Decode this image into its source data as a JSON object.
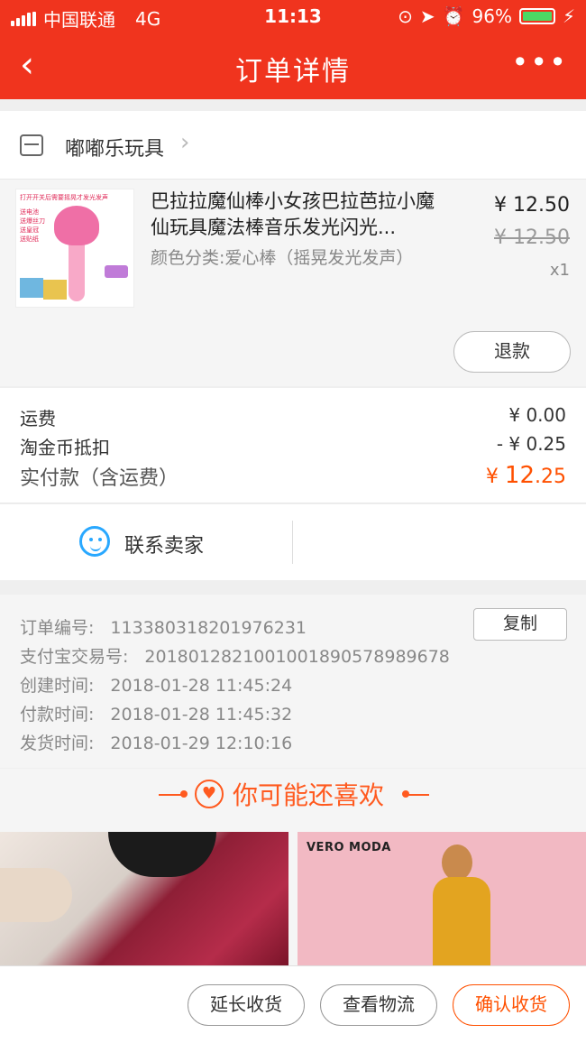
{
  "status": {
    "carrier": "中国联通",
    "network": "4G",
    "time": "11:13",
    "battery": "96%"
  },
  "nav": {
    "title": "订单详情",
    "back_icon": "back-chevron-icon",
    "more_icon": "more-dots-icon"
  },
  "shop": {
    "name": "嘟嘟乐玩具"
  },
  "product": {
    "title": "巴拉拉魔仙棒小女孩巴拉芭拉小魔仙玩具魔法棒音乐发光闪光...",
    "sku": "颜色分类:爱心棒（摇晃发光发声）",
    "price": "¥ 12.50",
    "original_price": "¥ 12.50",
    "qty": "x1",
    "thumb_text": "打开开关后需要摇晃才发光发声",
    "thumb_text2": "送电池 送爆丝刀 送皇冠 送贴纸",
    "refund_label": "退款"
  },
  "costs": {
    "shipping_label": "运费",
    "shipping_value": "¥ 0.00",
    "coin_label": "淘金币抵扣",
    "coin_value": "- ¥ 0.25",
    "total_label": "实付款（含运费）",
    "total_prefix": "¥ ",
    "total_int": "12",
    "total_dec": ".25"
  },
  "contact": {
    "label": "联系卖家"
  },
  "order_info": {
    "order_no_label": "订单编号:",
    "order_no": "113380318201976231",
    "alipay_label": "支付宝交易号:",
    "alipay_no": "2018012821001001890578989678",
    "created_label": "创建时间:",
    "created": "2018-01-28 11:45:24",
    "paid_label": "付款时间:",
    "paid": "2018-01-28 11:45:32",
    "shipped_label": "发货时间:",
    "shipped": "2018-01-29 12:10:16",
    "copy_label": "复制"
  },
  "recommend": {
    "title": "你可能还喜欢"
  },
  "recommend_items": {
    "brand2": "VERO MODA"
  },
  "actions": {
    "extend": "延长收货",
    "logistics": "查看物流",
    "confirm": "确认收货"
  },
  "colors": {
    "primary": "#f0341e",
    "accent": "#ff5000",
    "link": "#29a8ff"
  }
}
